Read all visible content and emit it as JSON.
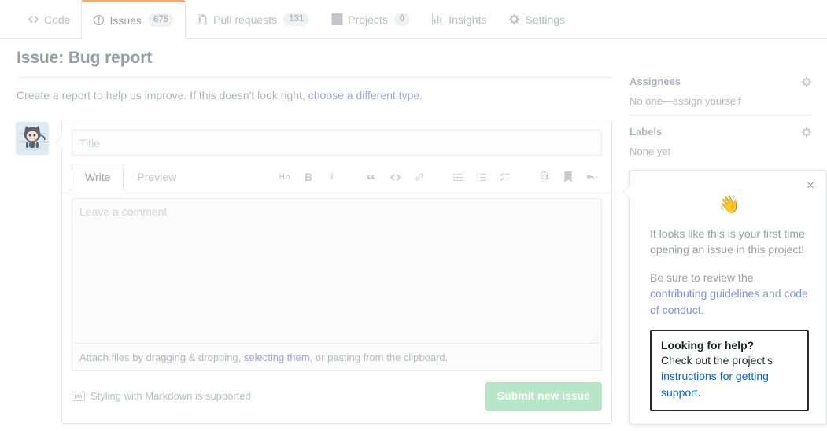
{
  "repo_nav": {
    "tabs": [
      {
        "label": "Code",
        "icon": "code-icon",
        "count": null,
        "selected": false
      },
      {
        "label": "Issues",
        "icon": "issue-opened-icon",
        "count": "675",
        "selected": true
      },
      {
        "label": "Pull requests",
        "icon": "git-pull-request-icon",
        "count": "131",
        "selected": false
      },
      {
        "label": "Projects",
        "icon": "project-icon",
        "count": "0",
        "selected": false
      },
      {
        "label": "Insights",
        "icon": "graph-icon",
        "count": null,
        "selected": false
      },
      {
        "label": "Settings",
        "icon": "gear-icon",
        "count": null,
        "selected": false
      }
    ]
  },
  "header": {
    "title": "Issue: Bug report",
    "subtitle_before": "Create a report to help us improve. If this doesn't look right, ",
    "subtitle_link": "choose a different type",
    "subtitle_after": "."
  },
  "form": {
    "title_placeholder": "Title",
    "title_value": "",
    "tabs": [
      {
        "label": "Write",
        "active": true
      },
      {
        "label": "Preview",
        "active": false
      }
    ],
    "toolbar": [
      {
        "name": "heading-icon",
        "glyph": "AA"
      },
      {
        "name": "bold-icon",
        "glyph": "B"
      },
      {
        "name": "italic-icon",
        "glyph": "i"
      },
      {
        "name": "quote-icon",
        "glyph": "“"
      },
      {
        "name": "code-icon",
        "glyph": "<>"
      },
      {
        "name": "link-icon",
        "glyph": "link"
      },
      {
        "name": "unordered-list-icon",
        "glyph": "ul"
      },
      {
        "name": "ordered-list-icon",
        "glyph": "ol"
      },
      {
        "name": "task-list-icon",
        "glyph": "task"
      },
      {
        "name": "mention-icon",
        "glyph": "@"
      },
      {
        "name": "saved-reply-icon",
        "glyph": "bookmark"
      },
      {
        "name": "reply-icon",
        "glyph": "reply"
      }
    ],
    "comment_placeholder": "Leave a comment",
    "comment_value": "",
    "attach_before": "Attach files by dragging & dropping, ",
    "attach_link": "selecting them",
    "attach_after": ", or pasting from the clipboard.",
    "markdown_note": "Styling with Markdown is supported",
    "submit_label": "Submit new issue"
  },
  "sidebar": {
    "sections": [
      {
        "title": "Assignees",
        "body": "No one—assign yourself",
        "gear": "gear-icon"
      },
      {
        "title": "Labels",
        "body": "None yet",
        "gear": "gear-icon"
      }
    ]
  },
  "popup": {
    "close_label": "×",
    "wave": "👋",
    "paragraph1": "It looks like this is your first time opening an issue in this project!",
    "p2_before": "Be sure to review the ",
    "p2_link1": "contributing guidelines",
    "p2_mid": " and ",
    "p2_link2": "code of conduct",
    "p2_after": ".",
    "help_title": "Looking for help?",
    "help_before": "Check out the project's ",
    "help_link": "instructions for getting support",
    "help_after": "."
  },
  "colors": {
    "accent_orange": "#f0a878",
    "link_blue": "#0366d6",
    "muted_link": "#9aa7dd",
    "submit_green": "#b8e6c8",
    "focus_border": "#24292e"
  }
}
